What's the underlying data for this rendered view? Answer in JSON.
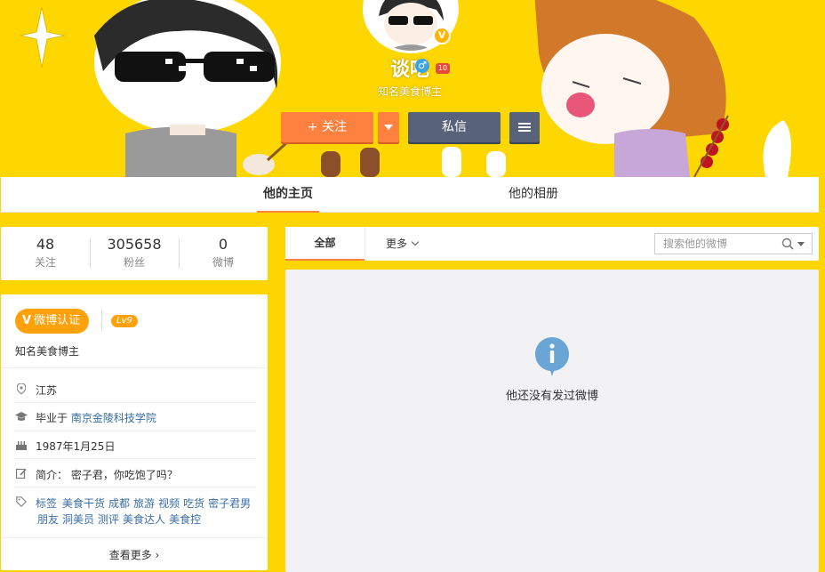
{
  "profile": {
    "name": "谈吃",
    "description": "知名美食博主",
    "verified_mark": "V",
    "gender_symbol": "♂",
    "medal_text": "10"
  },
  "actions": {
    "follow_label": "+ 关注",
    "message_label": "私信"
  },
  "tabs": {
    "home": "他的主页",
    "album": "他的相册"
  },
  "counts": [
    {
      "value": "48",
      "label": "关注"
    },
    {
      "value": "305658",
      "label": "粉丝"
    },
    {
      "value": "0",
      "label": "微博"
    }
  ],
  "info": {
    "verify_label": "微博认证",
    "verify_mark": "V",
    "level": "Lv9",
    "title": "知名美食博主",
    "location": "江苏",
    "education_prefix": "毕业于",
    "education_school": "南京金陵科技学院",
    "birthday": "1987年1月25日",
    "bio": "简介： 密子君，你吃饱了吗？",
    "tags_label": "标签",
    "tags_line1": [
      "美食干货",
      "成都",
      "旅游",
      "视频",
      "吃货",
      "密子君男"
    ],
    "tags_line2": [
      "朋友",
      "洞美员",
      "测评",
      "美食达人",
      "美食控"
    ],
    "see_more": "查看更多 ›"
  },
  "feed": {
    "filter_all": "全部",
    "filter_more": "更多",
    "search_placeholder": "搜索他的微博",
    "empty_text": "他还没有发过微博"
  },
  "colors": {
    "page_background": "#ffd500",
    "accent_orange": "#ff8140",
    "button_dark": "#586278",
    "verify_orange": "#ffa10a",
    "link_blue": "#3a6ea5"
  }
}
